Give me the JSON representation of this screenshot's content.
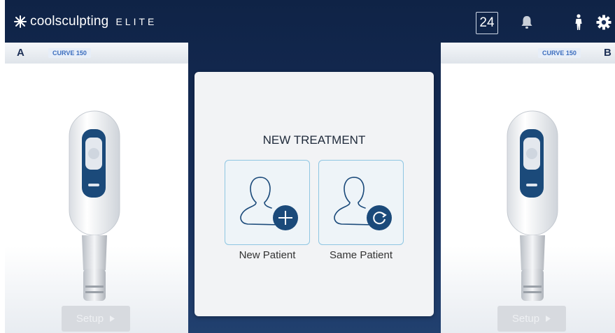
{
  "header": {
    "logo_text": "coolsculpting",
    "logo_suffix": "ELITE",
    "counter": "24",
    "icons": [
      "bell-icon",
      "person-icon",
      "gear-icon"
    ]
  },
  "applicator_a": {
    "letter": "A",
    "model": "CURVE 150",
    "setup_label": "Setup"
  },
  "applicator_b": {
    "letter": "B",
    "model": "CURVE 150",
    "setup_label": "Setup"
  },
  "dialog": {
    "title": "NEW TREATMENT",
    "options": [
      {
        "label": "New Patient",
        "icon": "patient-add-icon"
      },
      {
        "label": "Same Patient",
        "icon": "patient-refresh-icon"
      }
    ]
  },
  "colors": {
    "background": "#182f5b",
    "accent": "#1b4a7a",
    "option_border": "#8fc6e2",
    "disabled_button": "#d7dadf"
  }
}
